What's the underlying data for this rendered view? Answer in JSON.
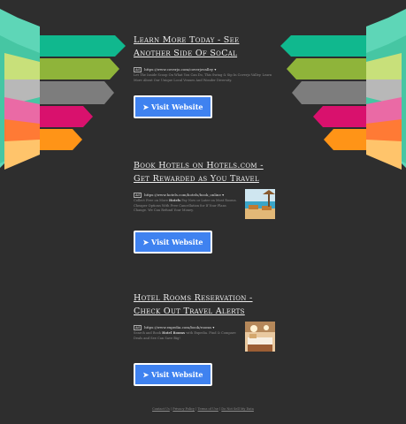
{
  "results": [
    {
      "headline": "Learn More Today - See Another Side Of SoCal",
      "ad_label": "Ad",
      "url": "https://www.coverjo.com/coverjovalley",
      "desc_pre": "Let The Inside Scoop On What You Can Do, This Swing & Sip In Coverjo Valley. Learn More About Our Unique Local Venues And Wonder Diversity.",
      "desc_bold": "",
      "desc_post": "",
      "button_label": "Visit Website",
      "has_thumb": false
    },
    {
      "headline": "Book Hotels on Hotels.com - Get Rewarded as You Travel",
      "ad_label": "Ad",
      "url": "https://www.hotels.com/hotels/book_online",
      "desc_pre": "Collect Free on More ",
      "desc_bold": "Hotels",
      "desc_post": " Pay Now or Later on Most Rooms. Cheaper Options With Free Cancellation for If Your Plans Change. We Can Refund Your Money.",
      "button_label": "Visit Website",
      "has_thumb": true
    },
    {
      "headline": "Hotel Rooms Reservation - Check Out Travel Alerts",
      "ad_label": "Ad",
      "url": "https://www.expedia.com/book/rooms",
      "desc_pre": "Search and Book ",
      "desc_bold": "Hotel Rooms",
      "desc_post": " with Expedia. Find & Compare Deals and See Can Save Big!",
      "button_label": "Visit Website",
      "has_thumb": true
    }
  ],
  "footer": {
    "links": [
      "Contact Us",
      "Privacy Policy",
      "Terms of Use",
      "Do Not Sell My Data"
    ],
    "separator": "|"
  },
  "ribbon_colors": [
    "#5ed6b7",
    "#10b88e",
    "#8fb43a",
    "#7a7a7a",
    "#d9116d",
    "#ff9417",
    "#ffc46b"
  ]
}
